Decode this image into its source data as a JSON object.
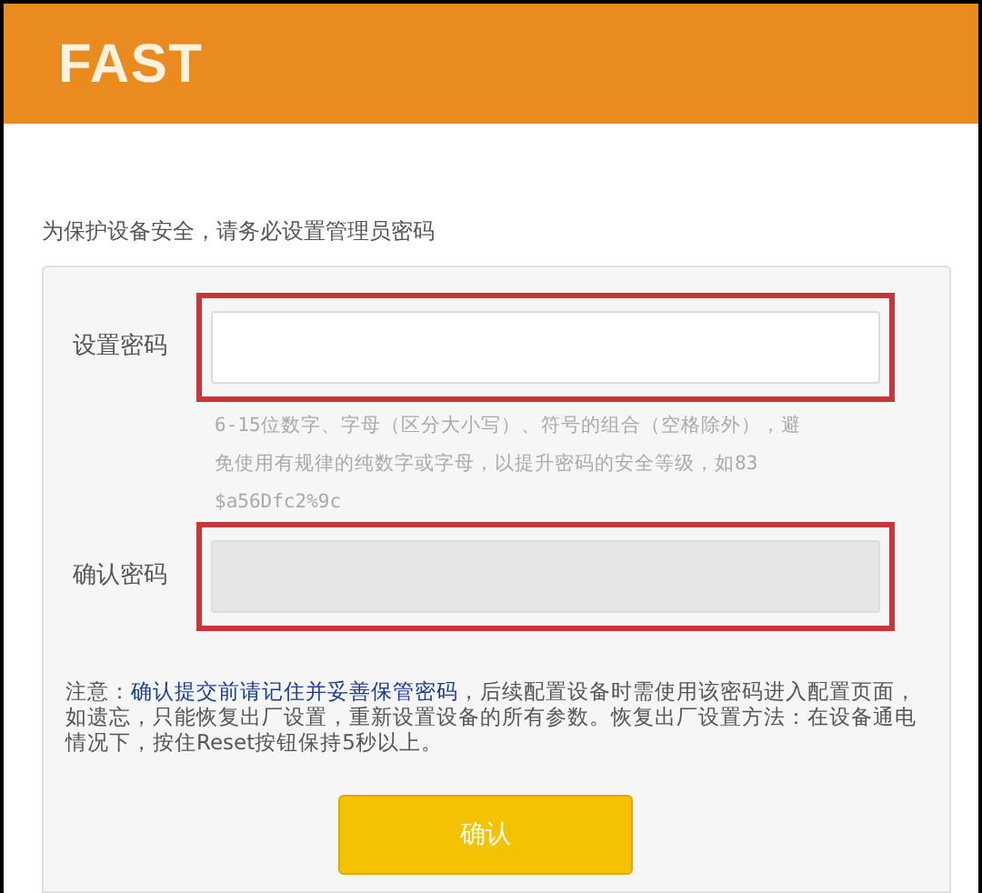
{
  "header": {
    "logo": "FAST"
  },
  "intro": "为保护设备安全，请务必设置管理员密码",
  "fields": [
    {
      "label": "设置密码",
      "disabled": false,
      "highlighted": true
    },
    {
      "label": "确认密码",
      "disabled": true,
      "highlighted": true
    }
  ],
  "hint_lines": [
    "6-15位数字、字母（区分大小写）、符号的组合（空格除外），避",
    "免使用有规律的纯数字或字母，以提升密码的安全等级，如83",
    "$a56Dfc2%9c"
  ],
  "note": {
    "prefix": "注意：",
    "link": "确认提交前请记住并妥善保管密码",
    "rest": "，后续配置设备时需使用该密码进入配置页面，如遗忘，只能恢复出厂设置，重新设置设备的所有参数。恢复出厂设置方法：在设备通电情况下，按住Reset按钮保持5秒以上。"
  },
  "button": "确认"
}
